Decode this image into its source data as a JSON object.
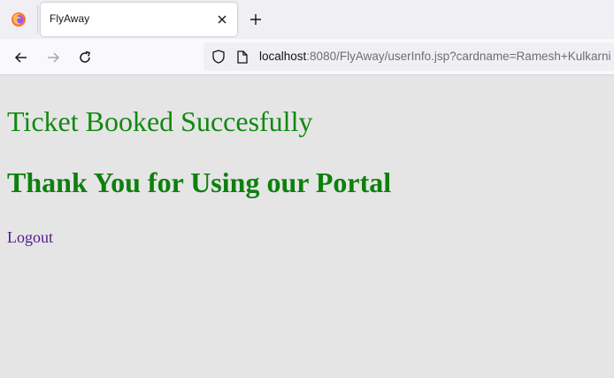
{
  "browser": {
    "tab": {
      "title": "FlyAway"
    },
    "url": {
      "host": "localhost",
      "rest": ":8080/FlyAway/userInfo.jsp?cardname=Ramesh+Kulkarni"
    },
    "icons": [
      "firefox-icon",
      "close-icon",
      "plus-icon",
      "back-arrow-icon",
      "forward-arrow-icon",
      "reload-icon",
      "shield-icon",
      "page-icon"
    ]
  },
  "page": {
    "message": "Ticket Booked Succesfully",
    "thanks": "Thank You for Using our Portal",
    "logout_label": "Logout"
  },
  "colors": {
    "message_green": "#118811",
    "thanks_green": "#0d800d",
    "visited_link": "#551a8b",
    "page_background": "#e5e5e5"
  }
}
